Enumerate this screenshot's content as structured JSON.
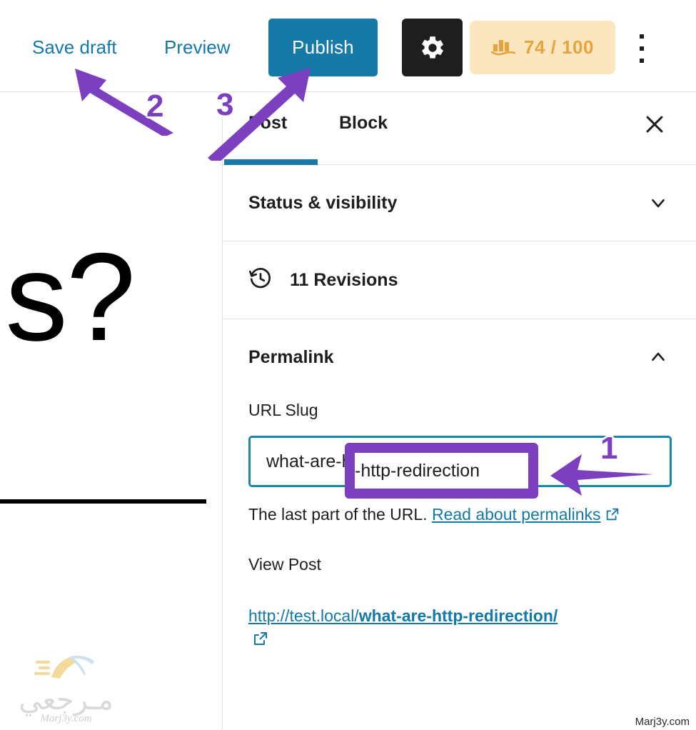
{
  "toolbar": {
    "save_draft_label": "Save draft",
    "preview_label": "Preview",
    "publish_label": "Publish",
    "settings_icon": "gear-icon",
    "seo_score_icon": "seo-bar-chart-icon",
    "seo_score_value": "74 / 100",
    "more_menu_icon": "vertical-ellipsis-icon"
  },
  "editor": {
    "title_fragment": "ns?",
    "watermark_arabic": "مـرجعي",
    "watermark_domain": "Marj3y.com"
  },
  "sidebar": {
    "tabs": [
      {
        "label": "Post",
        "active": true
      },
      {
        "label": "Block",
        "active": false
      }
    ],
    "close_icon": "close-icon",
    "panels": {
      "status_visibility": {
        "title": "Status & visibility",
        "chevron": "chevron-down-icon",
        "expanded": false
      },
      "revisions": {
        "label": "11 Revisions",
        "icon": "revisions-clock-icon"
      },
      "permalink": {
        "title": "Permalink",
        "chevron": "chevron-up-icon",
        "expanded": true,
        "url_slug_label": "URL Slug",
        "url_slug_value": "what-are-http-redirection",
        "url_slug_placeholder": "what-are-http-redirection",
        "help_text": "The last part of the URL.",
        "help_link_text": "Read about permalinks",
        "help_link_icon": "external-link-icon",
        "view_post_label": "View Post",
        "view_post_url_base": "http://test.local/",
        "view_post_url_slug": "what-are-http-redirection/",
        "view_post_link_icon": "external-link-icon"
      }
    }
  },
  "annotations": {
    "marker_1": "1",
    "marker_2": "2",
    "marker_3": "3",
    "highlight_text": "-http-redirection",
    "arrow_color": "#7b3fbf"
  },
  "corner_credit": "Marj3y.com",
  "colors": {
    "publish_blue": "#1679a8",
    "link_blue": "#1279a8",
    "seo_badge_bg": "#fbe6c0",
    "seo_badge_text": "#e8a33d",
    "annotation_purple": "#7b3fbf",
    "input_border": "#1b87a8",
    "gear_button_bg": "#1e1e1e"
  }
}
